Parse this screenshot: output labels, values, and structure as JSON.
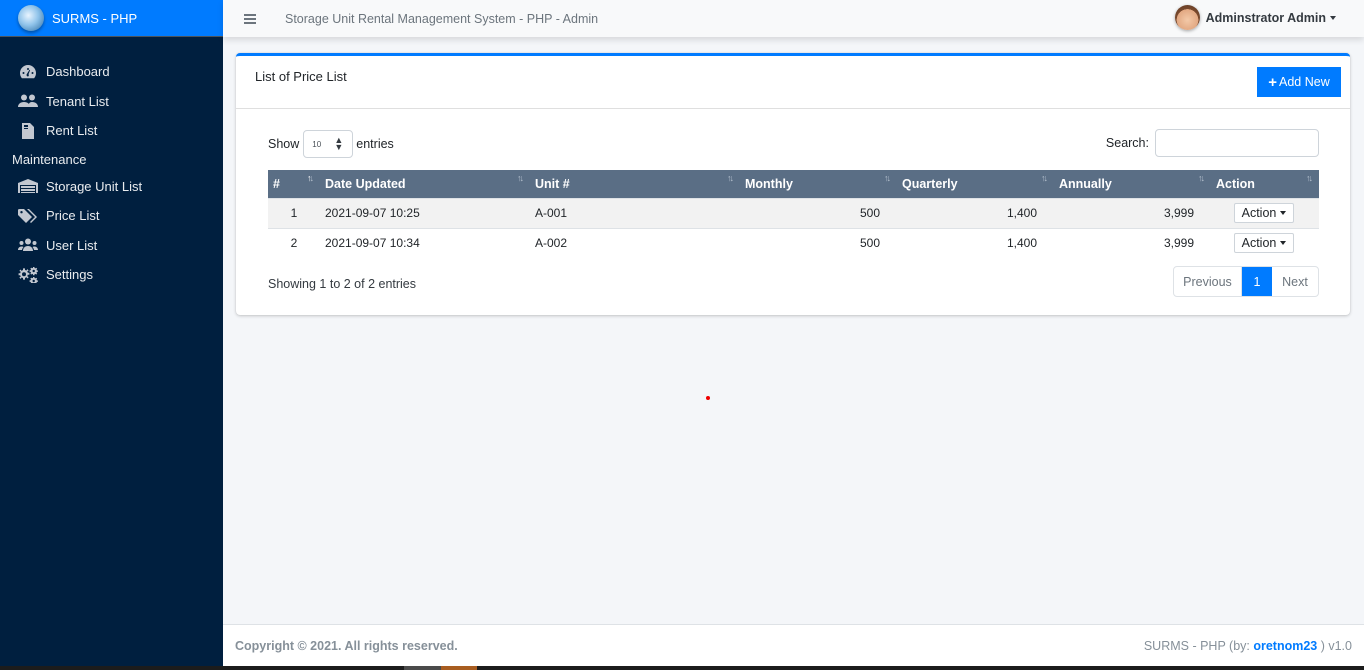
{
  "brand": {
    "name": "SURMS - PHP"
  },
  "topbar": {
    "title": "Storage Unit Rental Management System - PHP - Admin",
    "user_name": "Adminstrator Admin"
  },
  "sidebar": {
    "items": [
      {
        "label": "Dashboard",
        "icon": "tachometer-icon"
      },
      {
        "label": "Tenant List",
        "icon": "users-icon"
      },
      {
        "label": "Rent List",
        "icon": "file-invoice-icon"
      }
    ],
    "section_header": "Maintenance",
    "maintenance_items": [
      {
        "label": "Storage Unit List",
        "icon": "warehouse-icon"
      },
      {
        "label": "Price List",
        "icon": "tags-icon"
      },
      {
        "label": "User List",
        "icon": "users-cog-icon"
      },
      {
        "label": "Settings",
        "icon": "cogs-icon"
      }
    ]
  },
  "card": {
    "title": "List of Price List",
    "add_button": "Add New",
    "length": {
      "show_label": "Show",
      "value": "10",
      "entries_label": "entries"
    },
    "search": {
      "label": "Search:",
      "value": "",
      "placeholder": ""
    },
    "table": {
      "columns": [
        "#",
        "Date Updated",
        "Unit #",
        "Monthly",
        "Quarterly",
        "Annually",
        "Action"
      ],
      "rows": [
        {
          "index": "1",
          "date_updated": "2021-09-07 10:25",
          "unit": "A-001",
          "monthly": "500",
          "quarterly": "1,400",
          "annually": "3,999",
          "action": "Action"
        },
        {
          "index": "2",
          "date_updated": "2021-09-07 10:34",
          "unit": "A-002",
          "monthly": "500",
          "quarterly": "1,400",
          "annually": "3,999",
          "action": "Action"
        }
      ]
    },
    "info": "Showing 1 to 2 of 2 entries",
    "pagination": {
      "previous": "Previous",
      "current_page": "1",
      "next": "Next"
    }
  },
  "footer": {
    "copyright": "Copyright © 2021. All rights reserved.",
    "credit_prefix": "SURMS - PHP (by: ",
    "credit_author": "oretnom23",
    "credit_suffix": " ) v1.0"
  },
  "colors": {
    "primary": "#007bff",
    "sidebar_bg": "#001f3f",
    "table_header_bg": "#5a6e85"
  }
}
